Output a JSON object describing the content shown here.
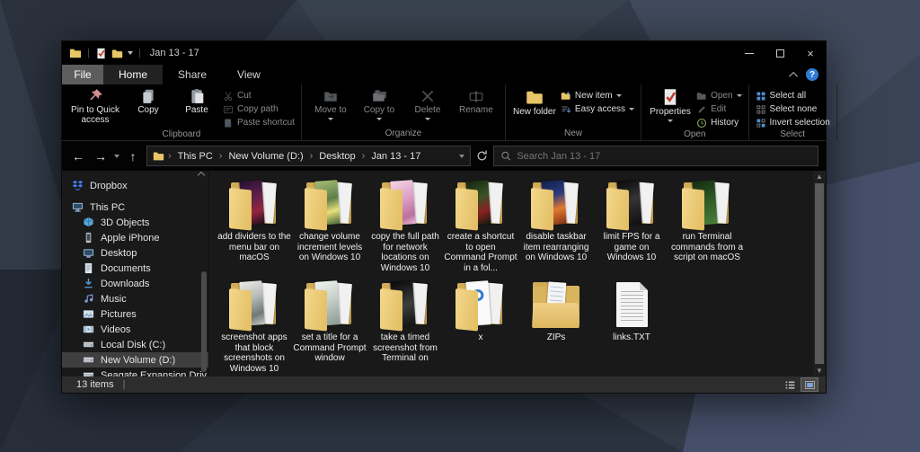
{
  "titlebar": {
    "title": "Jan 13 - 17",
    "quick_access_icons": [
      "folder-icon",
      "properties-icon",
      "new-folder-icon"
    ],
    "controls": [
      "minimize",
      "maximize",
      "close"
    ]
  },
  "tabs": {
    "file": "File",
    "items": [
      "Home",
      "Share",
      "View"
    ],
    "active": "Home"
  },
  "ribbon": {
    "groups": [
      {
        "label": "Clipboard",
        "buttons": {
          "pin": "Pin to Quick access",
          "copy": "Copy",
          "paste": "Paste",
          "cut": "Cut",
          "copy_path": "Copy path",
          "paste_shortcut": "Paste shortcut"
        }
      },
      {
        "label": "Organize",
        "buttons": {
          "move_to": "Move to",
          "copy_to": "Copy to",
          "delete": "Delete",
          "rename": "Rename"
        }
      },
      {
        "label": "New",
        "buttons": {
          "new_folder": "New folder",
          "new_item": "New item",
          "easy_access": "Easy access"
        }
      },
      {
        "label": "Open",
        "buttons": {
          "properties": "Properties",
          "open": "Open",
          "edit": "Edit",
          "history": "History"
        }
      },
      {
        "label": "Select",
        "buttons": {
          "select_all": "Select all",
          "select_none": "Select none",
          "invert": "Invert selection"
        }
      }
    ]
  },
  "navbar": {
    "breadcrumb": [
      "This PC",
      "New Volume (D:)",
      "Desktop",
      "Jan 13 - 17"
    ],
    "search_placeholder": "Search Jan 13 - 17"
  },
  "sidebar": {
    "items": [
      {
        "label": "Dropbox",
        "icon": "dropbox-icon",
        "indent": 0
      },
      {
        "label": "This PC",
        "icon": "computer-icon",
        "indent": 0,
        "gap_before": true
      },
      {
        "label": "3D Objects",
        "icon": "cube-icon",
        "indent": 1
      },
      {
        "label": "Apple iPhone",
        "icon": "phone-icon",
        "indent": 1
      },
      {
        "label": "Desktop",
        "icon": "desktop-icon",
        "indent": 1
      },
      {
        "label": "Documents",
        "icon": "document-icon",
        "indent": 1
      },
      {
        "label": "Downloads",
        "icon": "download-icon",
        "indent": 1
      },
      {
        "label": "Music",
        "icon": "music-icon",
        "indent": 1
      },
      {
        "label": "Pictures",
        "icon": "pictures-icon",
        "indent": 1
      },
      {
        "label": "Videos",
        "icon": "videos-icon",
        "indent": 1
      },
      {
        "label": "Local Disk (C:)",
        "icon": "drive-icon",
        "indent": 1
      },
      {
        "label": "New Volume (D:)",
        "icon": "drive-icon",
        "indent": 1,
        "selected": true
      },
      {
        "label": "Seagate Expansion Driv",
        "icon": "drive-icon",
        "indent": 1,
        "clipped": true
      }
    ]
  },
  "content": {
    "items": [
      {
        "label": "add dividers to the menu bar on macOS",
        "type": "folder-preview",
        "thumb": "linear-gradient(160deg,#241031 0%,#5e1f4a 40%,#93263e 70%,#1c0f1e 100%)"
      },
      {
        "label": "change volume increment levels on Windows 10",
        "type": "folder-preview",
        "thumb": "linear-gradient(165deg,#a8bd72 0%,#5d7f4a 45%,#e8e07a 70%,#44663a 100%)"
      },
      {
        "label": "copy the full path for network locations on Windows 10",
        "type": "folder-preview",
        "thumb": "linear-gradient(160deg,#f4d4e6 0%,#dd9ec6 45%,#bb6f9f 80%,#e8bcd6 100%)"
      },
      {
        "label": "create a shortcut to open Command Prompt in a fol...",
        "type": "folder-preview",
        "thumb": "linear-gradient(160deg,#16230f 0%,#375426 40%,#8a2222 70%,#101a0c 100%)"
      },
      {
        "label": "disable taskbar item rearranging on Windows 10",
        "type": "folder-preview",
        "thumb": "linear-gradient(165deg,#13204d 0%,#2b3a80 35%,#e2792f 65%,#7e3418 100%)"
      },
      {
        "label": "limit FPS for a game on Windows 10",
        "type": "folder-preview",
        "thumb": "linear-gradient(165deg,#0a0a0a 0%,#343434 45%,#101010 100%)"
      },
      {
        "label": "run Terminal commands from a script on macOS",
        "type": "folder-preview",
        "thumb": "linear-gradient(160deg,#152a10 0%,#2f5a26 50%,#49803a 100%)"
      },
      {
        "label": "screenshot apps that block screenshots on Windows 10",
        "type": "folder-preview",
        "thumb": "linear-gradient(160deg,#ecece8 0%,#b8bcb8 40%,#6e7a76 75%,#c8cac6 100%)"
      },
      {
        "label": "set a title for a Command Prompt window",
        "type": "folder-preview",
        "thumb": "linear-gradient(160deg,#f0f4f1 0%,#c6d0ca 45%,#8b9892 100%)"
      },
      {
        "label": "take a timed screenshot from Terminal on",
        "type": "folder-preview",
        "thumb": "linear-gradient(165deg,#090909 0%,#3d3d3d 55%,#141414 100%)"
      },
      {
        "label": "x",
        "type": "folder-doc"
      },
      {
        "label": "ZIPs",
        "type": "folder-plain"
      },
      {
        "label": "links.TXT",
        "type": "file-txt"
      }
    ]
  },
  "statusbar": {
    "items_count": "13 items"
  },
  "colors": {
    "accent_blue": "#2e7cd6",
    "folder_yellow": "#e8c667",
    "window_bg": "#191919",
    "ribbon_bg": "#000000",
    "selection_gray": "#3f3f3f"
  }
}
